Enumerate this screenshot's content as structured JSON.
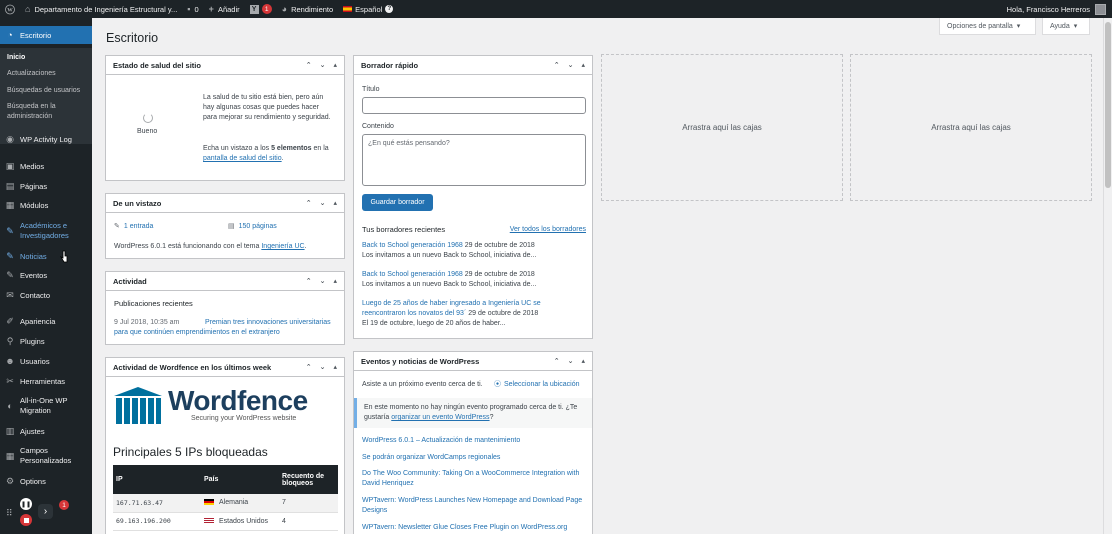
{
  "adminbar": {
    "site_name": "Departamento de Ingeniería Estructural y...",
    "comments_count": "0",
    "add_new": "Añadir",
    "yoast_count": "1",
    "performance": "Rendimiento",
    "language": "Español",
    "greeting": "Hola, Francisco Herreros"
  },
  "sidebar": {
    "dashboard": "Escritorio",
    "submenu": [
      "Inicio",
      "Actualizaciones",
      "Búsquedas de usuarios",
      "Búsqueda en la administración"
    ],
    "items": [
      {
        "label": "WP Activity Log"
      },
      {
        "label": "Medios"
      },
      {
        "label": "Páginas"
      },
      {
        "label": "Módulos"
      },
      {
        "label": "Académicos e Investigadores"
      },
      {
        "label": "Noticias"
      },
      {
        "label": "Eventos"
      },
      {
        "label": "Contacto"
      },
      {
        "label": "Apariencia"
      },
      {
        "label": "Plugins"
      },
      {
        "label": "Usuarios"
      },
      {
        "label": "Herramientas"
      },
      {
        "label": "All-in-One WP Migration"
      },
      {
        "label": "Ajustes"
      },
      {
        "label": "Campos Personalizados"
      },
      {
        "label": "Options"
      }
    ],
    "notif_count": "1"
  },
  "header": {
    "title": "Escritorio",
    "screen_options": "Opciones de pantalla",
    "help": "Ayuda"
  },
  "site_health": {
    "title": "Estado de salud del sitio",
    "status": "Bueno",
    "text": "La salud de tu sitio está bien, pero aún hay algunas cosas que puedes hacer para mejorar su rendimiento y seguridad.",
    "text2_prefix": "Echa un vistazo a los ",
    "text2_bold": "5 elementos",
    "text2_mid": " en la ",
    "text2_link": "pantalla de salud del sitio",
    "text2_suffix": "."
  },
  "glance": {
    "title": "De un vistazo",
    "posts": "1 entrada",
    "pages": "150 páginas",
    "footer_prefix": "WordPress 6.0.1 está funcionando con el tema ",
    "theme_link": "Ingeniería UC",
    "footer_suffix": "."
  },
  "activity": {
    "title": "Actividad",
    "subtitle": "Publicaciones recientes",
    "date": "9 Jul 2018, 10:35 am",
    "post_link": "Premian tres innovaciones universitarias para que continúen emprendimientos en el extranjero"
  },
  "wordfence": {
    "title": "Actividad de Wordfence en los últimos week",
    "logo_text": "Wordfence",
    "logo_tagline": "Securing your WordPress website",
    "table_title": "Principales 5 IPs bloqueadas",
    "headers": [
      "IP",
      "País",
      "Recuento de bloqueos"
    ],
    "rows": [
      {
        "ip": "167.71.63.47",
        "country": "Alemania",
        "count": "7"
      },
      {
        "ip": "69.163.196.200",
        "country": "Estados Unidos",
        "count": "4"
      }
    ]
  },
  "quick_draft": {
    "title": "Borrador rápido",
    "title_label": "Título",
    "title_value": "",
    "content_label": "Contenido",
    "content_placeholder": "¿En qué estás pensando?",
    "save_label": "Guardar borrador",
    "recent_label": "Tus borradores recientes",
    "view_all": "Ver todos los borradores",
    "drafts": [
      {
        "title": "Back to School generación 1968",
        "date": "29 de octubre de 2018",
        "excerpt": "Los invitamos a un nuevo Back to School, iniciativa de..."
      },
      {
        "title": "Back to School generación 1968",
        "date": "29 de octubre de 2018",
        "excerpt": "Los invitamos a un nuevo Back to School, iniciativa de..."
      },
      {
        "title": "Luego de 25 años de haber ingresado a Ingeniería UC se reencontraron los novatos del 93´",
        "date": "29 de octubre de 2018",
        "excerpt": "El 19 de octubre, luego de 20 años de haber..."
      }
    ]
  },
  "events": {
    "title": "Eventos y noticias de WordPress",
    "attend_text": "Asiste a un próximo evento cerca de ti.",
    "select_location": "Seleccionar la ubicación",
    "notice_text": "En este momento no hay ningún evento programado cerca de ti. ¿Te gustaría ",
    "notice_link": "organizar un evento WordPress",
    "notice_suffix": "?",
    "news": [
      "WordPress 6.0.1 – Actualización de mantenimiento",
      "Se podrán organizar WordCamps regionales",
      "Do The Woo Community: Taking On a WooCommerce Integration with David Henriquez",
      "WPTavern: WordPress Launches New Homepage and Download Page Designs",
      "WPTavern: Newsletter Glue Closes Free Plugin on WordPress.org"
    ]
  },
  "dropzones": {
    "label_1": "Arrastra aquí las cajas",
    "label_2": "Arrastra aquí las cajas"
  }
}
